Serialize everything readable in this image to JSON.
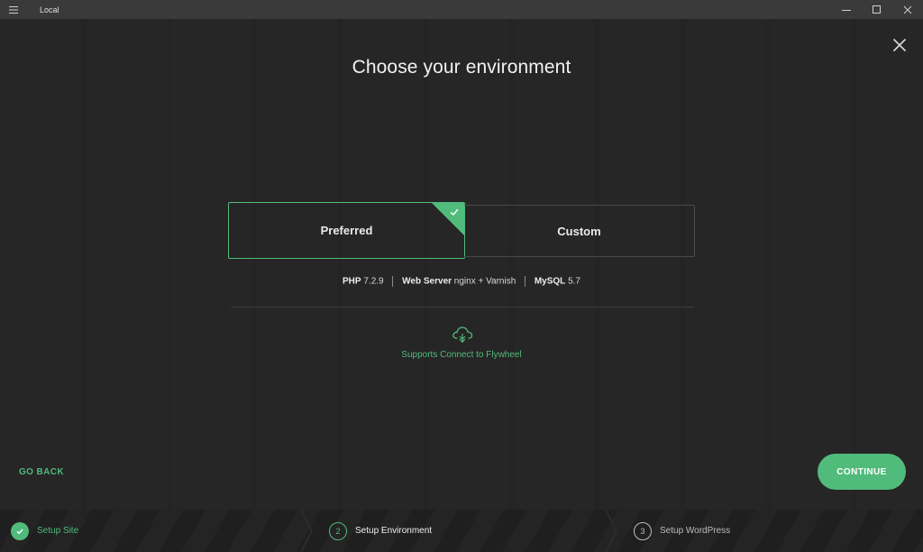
{
  "window": {
    "app_title": "Local"
  },
  "page": {
    "title": "Choose your environment"
  },
  "environment": {
    "options": [
      {
        "label": "Preferred",
        "selected": true
      },
      {
        "label": "Custom",
        "selected": false
      }
    ],
    "specs": [
      {
        "key": "PHP",
        "value": "7.2.9"
      },
      {
        "key": "Web Server",
        "value": "nginx + Varnish"
      },
      {
        "key": "MySQL",
        "value": "5.7"
      }
    ],
    "flywheel_text": "Supports Connect to Flywheel"
  },
  "actions": {
    "go_back": "GO BACK",
    "continue": "CONTINUE"
  },
  "steps": [
    {
      "number": "1",
      "label": "Setup Site",
      "state": "complete"
    },
    {
      "number": "2",
      "label": "Setup Environment",
      "state": "current"
    },
    {
      "number": "3",
      "label": "Setup WordPress",
      "state": "upcoming"
    }
  ],
  "colors": {
    "accent": "#51bb7b",
    "background": "#262626",
    "titlebar": "#3a3a3a"
  },
  "icons": {
    "menu": "hamburger-menu-icon",
    "minimize": "minimize-icon",
    "maximize": "maximize-icon",
    "close": "close-icon",
    "dismiss": "close-x-icon",
    "check": "check-icon",
    "flywheel": "cloud-flywheel-icon"
  }
}
